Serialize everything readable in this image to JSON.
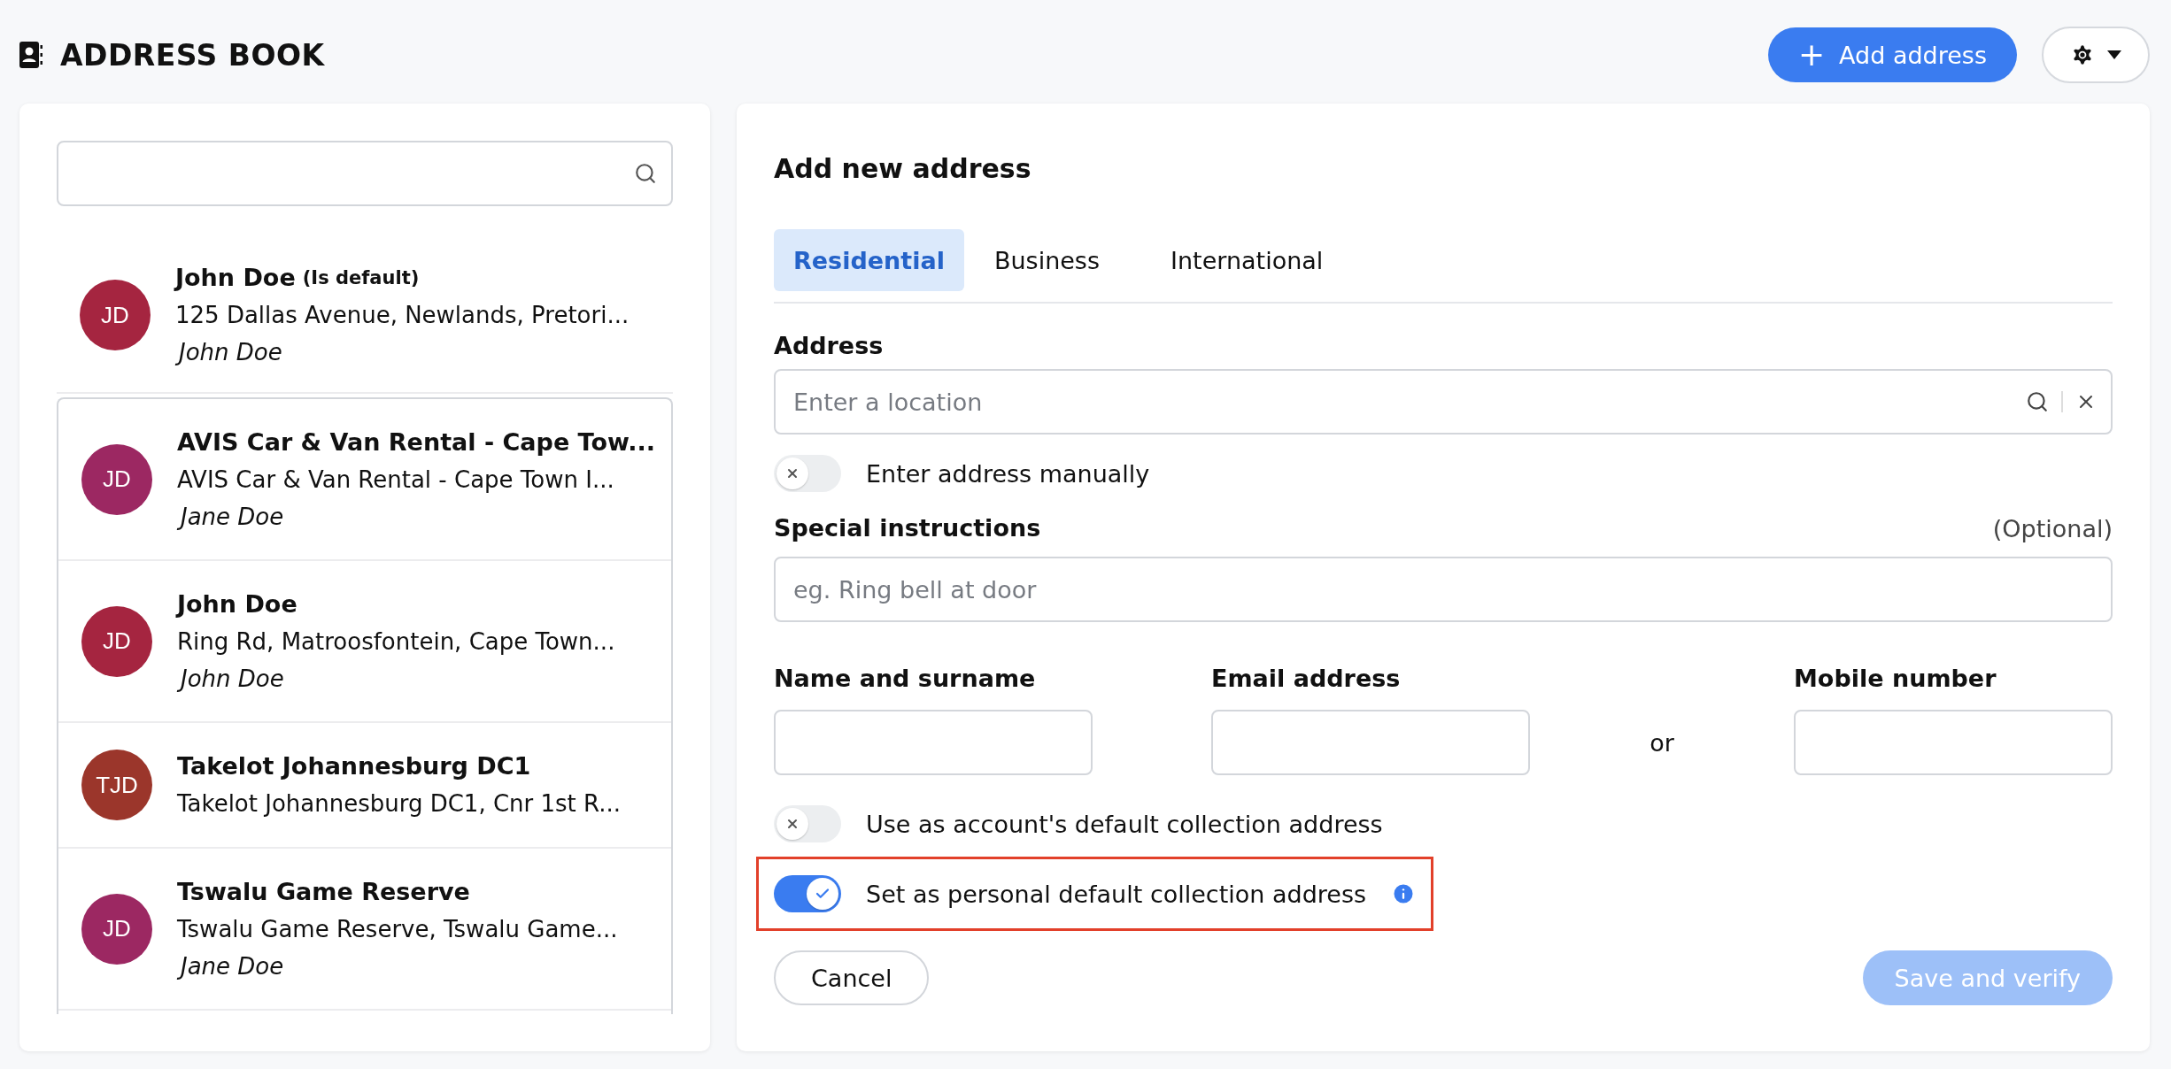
{
  "header": {
    "title": "ADDRESS BOOK",
    "add_button": {
      "icon": "+",
      "label": "Add address"
    }
  },
  "sidebar": {
    "default_item": {
      "initials": "JD",
      "color": "#a52540",
      "name": "John Doe",
      "badge": "(Is default)",
      "address": "125 Dallas Avenue, Newlands, Pretori...",
      "contact": "John Doe"
    },
    "items": [
      {
        "initials": "JD",
        "color": "#9c2862",
        "name": "AVIS Car & Van Rental - Cape Tow...",
        "address": "AVIS Car & Van Rental - Cape Town I...",
        "contact": "Jane Doe"
      },
      {
        "initials": "JD",
        "color": "#a52540",
        "name": "John Doe",
        "address": "Ring Rd, Matroosfontein, Cape Town...",
        "contact": "John Doe"
      },
      {
        "initials": "TJD",
        "color": "#9b362b",
        "name": "Takelot Johannesburg DC1",
        "address": "Takelot Johannesburg DC1, Cnr 1st R..."
      },
      {
        "initials": "JD",
        "color": "#9c2862",
        "name": "Tswalu Game Reserve",
        "address": "Tswalu Game Reserve, Tswalu Game...",
        "contact": "Jane Doe"
      }
    ]
  },
  "form": {
    "title": "Add new address",
    "tabs": [
      {
        "label": "Residential",
        "selected": true
      },
      {
        "label": "Business",
        "selected": false
      },
      {
        "label": "International",
        "selected": false
      }
    ],
    "address": {
      "label": "Address",
      "placeholder": "Enter a location"
    },
    "manual_toggle": {
      "label": "Enter address manually",
      "on": false
    },
    "instructions": {
      "label": "Special instructions",
      "optional": "(Optional)",
      "placeholder": "eg. Ring bell at door"
    },
    "contact": {
      "name_label": "Name and surname",
      "email_label": "Email address",
      "separator": "or",
      "mobile_label": "Mobile number"
    },
    "toggles": [
      {
        "label": "Use as account's default collection address",
        "on": false,
        "info": false,
        "highlighted": false
      },
      {
        "label": "Set as personal default collection address",
        "on": true,
        "info": true,
        "highlighted": true
      }
    ],
    "cancel": "Cancel",
    "save": {
      "label": "Save and verify",
      "disabled": true
    }
  }
}
